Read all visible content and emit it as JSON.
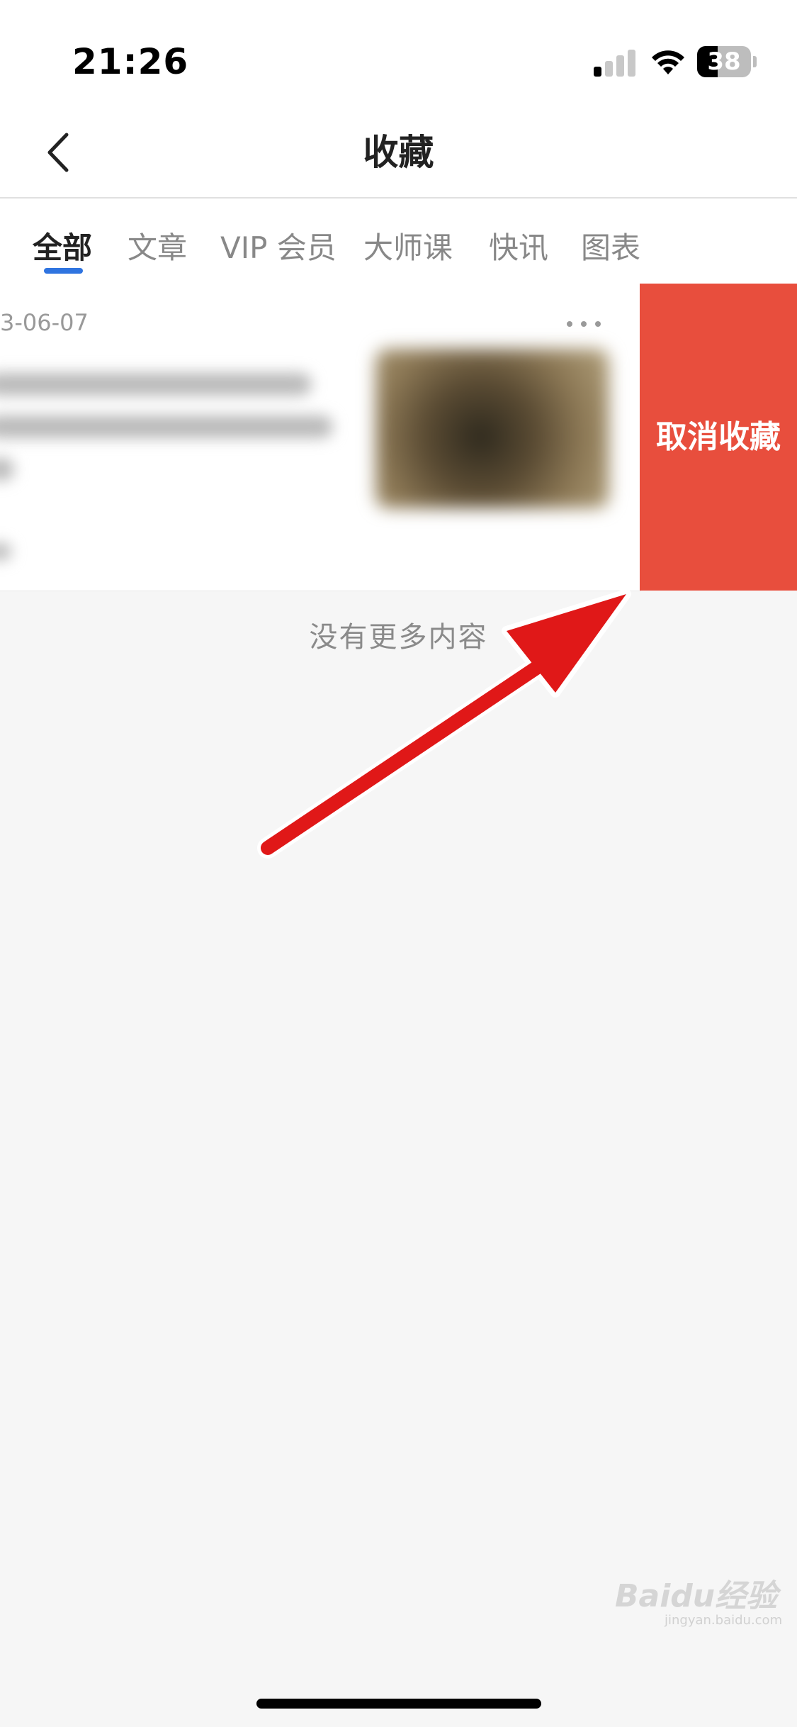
{
  "status_bar": {
    "time": "21:26",
    "battery_level": "38",
    "battery_fraction": 0.38,
    "signal_bars_active": 1,
    "signal_bars_total": 4,
    "icons": [
      "signal-icon",
      "wifi-icon",
      "battery-icon"
    ]
  },
  "nav": {
    "title": "收藏",
    "back_icon": "chevron-left-icon"
  },
  "tabs": [
    {
      "label": "全部",
      "active": true
    },
    {
      "label": "文章",
      "active": false
    },
    {
      "label": "VIP 会员",
      "active": false
    },
    {
      "label": "大师课",
      "active": false
    },
    {
      "label": "快讯",
      "active": false
    },
    {
      "label": "图表",
      "active": false
    }
  ],
  "list": {
    "items": [
      {
        "date": "3-06-07",
        "more_icon": "more-horizontal-icon",
        "swipe_action_label": "取消收藏"
      }
    ],
    "end_text": "没有更多内容"
  },
  "watermark": {
    "brand": "Baidu经验",
    "url": "jingyan.baidu.com"
  },
  "colors": {
    "accent_blue": "#2f74e0",
    "delete_red": "#e84e3d",
    "arrow_red": "#e01818",
    "background": "#f6f6f6"
  }
}
